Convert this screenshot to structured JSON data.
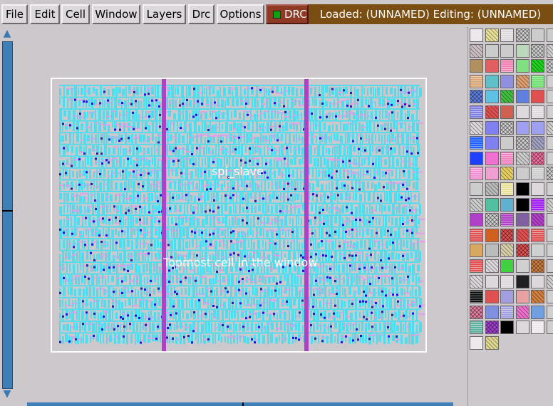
{
  "menubar": {
    "file": "File",
    "edit": "Edit",
    "cell": "Cell",
    "window": "Window",
    "layers": "Layers",
    "drc": "Drc",
    "options": "Options"
  },
  "drc_indicator": {
    "label": "DRC",
    "led_color": "#10a010"
  },
  "status": {
    "text": "Loaded: (UNNAMED) Editing: (UNNAMED)"
  },
  "layout": {
    "cell_name": "spi_slave",
    "top_label": "Topmost cell in the window",
    "colors": {
      "metal1": "#4fdcec",
      "local": "#e0a0e8",
      "contact": "#1a1ad8",
      "rail": "#b040c8",
      "boundary": "#ffffff"
    }
  },
  "scrollbars": {
    "up_icon": "arrow-up-icon",
    "down_icon": "arrow-down-icon",
    "color": "#3f7fb8"
  },
  "palette": {
    "icon_names": [
      "stipple-layer-icon",
      "hatched-layer-icon",
      "solid-layer-icon",
      "crossed-layer-icon"
    ],
    "colors": [
      "#ece8ec",
      "#e8e098",
      "#dcd8dc",
      "#cccccc",
      "#cccccc",
      "#cccccc",
      "#ccc0c4",
      "#cccccc",
      "#cccccc",
      "#bcd8bc",
      "#d0d0d0",
      "#d0d0d0",
      "#b09060",
      "#e06060",
      "#f080b0",
      "#80e080",
      "#20d020",
      "#d0d0d0",
      "#d8a878",
      "#60c0c8",
      "#9090e0",
      "#e0a070",
      "#70e070",
      "#d0d0d0",
      "#6080e0",
      "#60c0e0",
      "#40c040",
      "#6080e0",
      "#e05050",
      "#d0d0d0",
      "#8080e0",
      "#e05050",
      "#d06050",
      "#dcd8dc",
      "#dcd8dc",
      "#d0d0d0",
      "#dcd8dc",
      "#8080f0",
      "#cccccc",
      "#a0a0f0",
      "#a0a0f0",
      "#d0d0d0",
      "#2060ff",
      "#8080f0",
      "#cccccc",
      "#cccccc",
      "#a0a0c0",
      "#d0d0d0",
      "#2040ff",
      "#f070d0",
      "#f080c0",
      "#cccccc",
      "#f070a0",
      "#d0d0d0",
      "#f090d0",
      "#f0a0d0",
      "#e8d060",
      "#cccccc",
      "#cccccc",
      "#d0d0d0",
      "#cccccc",
      "#bcbcbc",
      "#e8e098",
      "#000000",
      "#dcd8dc",
      "#d0d0d0",
      "#cccccc",
      "#50c0a0",
      "#60b0d0",
      "#000000",
      "#a020f0",
      "#d0d0d0",
      "#b040c8",
      "#cccccc",
      "#b040c8",
      "#8060a0",
      "#b040c8",
      "#d0d0d0",
      "#e05050",
      "#d06020",
      "#e05050",
      "#e05050",
      "#e05050",
      "#d0d0d0",
      "#d8a860",
      "#bcbcbc",
      "#d8d0a8",
      "#e05050",
      "#d0d0d0",
      "#d0d0d0",
      "#e05050",
      "#dcd8dc",
      "#40d040",
      "#d0d0d0",
      "#d08040",
      "#d0d0d0",
      "#dcd8dc",
      "#dcd8dc",
      "#dcd8dc",
      "#202020",
      "#dcd8dc",
      "#d0d0d0",
      "#101010",
      "#e05050",
      "#a0a0e0",
      "#e8a0a0",
      "#d08040",
      "#d0d0d0",
      "#e080a0",
      "#8090e0",
      "#a0a0e0",
      "#f070d0",
      "#70a0e0",
      "#d0d0d0",
      "#60b0a0",
      "#a040d0",
      "#000000",
      "#dcd8dc",
      "#ece8ec",
      "#d0d0d0",
      "#ece8ec",
      "#e0d890"
    ]
  }
}
